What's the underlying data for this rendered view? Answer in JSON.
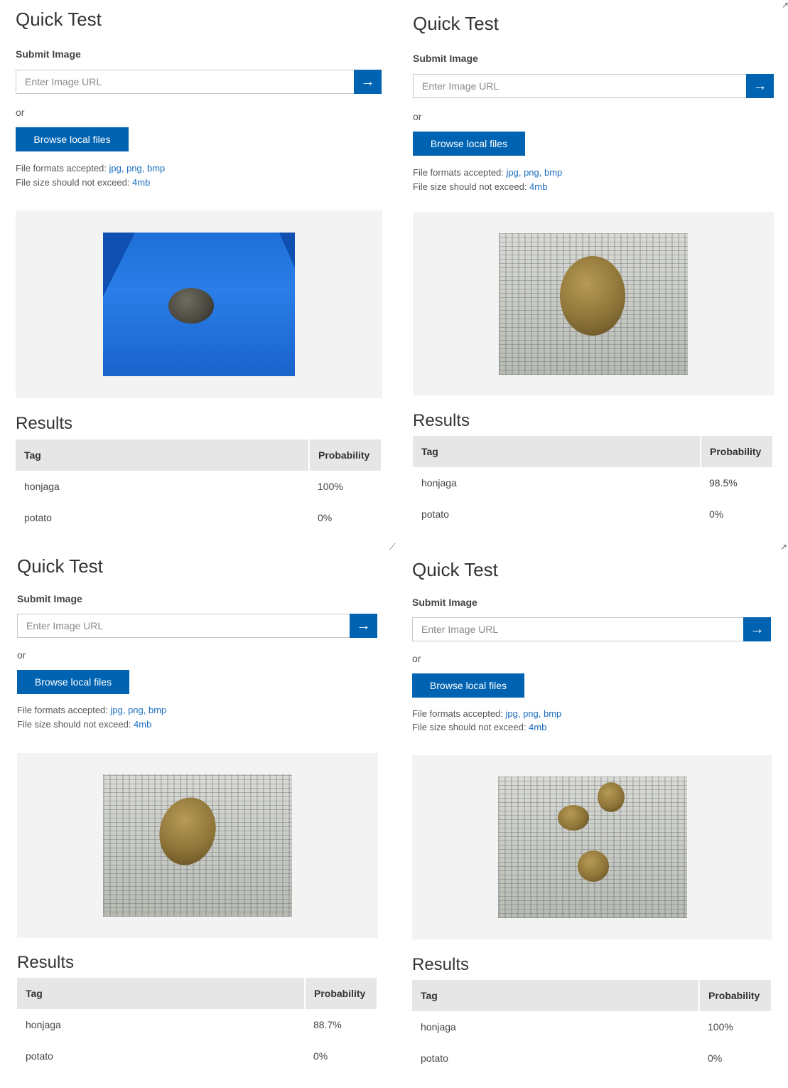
{
  "panels": [
    {
      "title": "Quick Test",
      "submit_label": "Submit Image",
      "url_placeholder": "Enter Image URL",
      "or": "or",
      "browse_label": "Browse local files",
      "formats_label": "File formats accepted: ",
      "formats": "jpg, png, bmp",
      "size_label": "File size should not exceed: ",
      "size": "4mb",
      "results_title": "Results",
      "col_tag": "Tag",
      "col_prob": "Probability",
      "rows": [
        {
          "tag": "honjaga",
          "prob": "100%"
        },
        {
          "tag": "potato",
          "prob": "0%"
        }
      ]
    },
    {
      "title": "Quick Test",
      "submit_label": "Submit Image",
      "url_placeholder": "Enter Image URL",
      "or": "or",
      "browse_label": "Browse local files",
      "formats_label": "File formats accepted: ",
      "formats": "jpg, png, bmp",
      "size_label": "File size should not exceed: ",
      "size": "4mb",
      "results_title": "Results",
      "col_tag": "Tag",
      "col_prob": "Probability",
      "rows": [
        {
          "tag": "honjaga",
          "prob": "98.5%"
        },
        {
          "tag": "potato",
          "prob": "0%"
        }
      ]
    },
    {
      "title": "Quick Test",
      "submit_label": "Submit Image",
      "url_placeholder": "Enter Image URL",
      "or": "or",
      "browse_label": "Browse local files",
      "formats_label": "File formats accepted: ",
      "formats": "jpg, png, bmp",
      "size_label": "File size should not exceed: ",
      "size": "4mb",
      "results_title": "Results",
      "col_tag": "Tag",
      "col_prob": "Probability",
      "rows": [
        {
          "tag": "honjaga",
          "prob": "88.7%"
        },
        {
          "tag": "potato",
          "prob": "0%"
        }
      ]
    },
    {
      "title": "Quick Test",
      "submit_label": "Submit Image",
      "url_placeholder": "Enter Image URL",
      "or": "or",
      "browse_label": "Browse local files",
      "formats_label": "File formats accepted: ",
      "formats": "jpg, png, bmp",
      "size_label": "File size should not exceed: ",
      "size": "4mb",
      "results_title": "Results",
      "col_tag": "Tag",
      "col_prob": "Probability",
      "rows": [
        {
          "tag": "honjaga",
          "prob": "100%"
        },
        {
          "tag": "potato",
          "prob": "0%"
        }
      ]
    }
  ],
  "icons": {
    "go": "arrow-right-icon",
    "corner": "expand-icon"
  },
  "colors": {
    "accent": "#0063b1",
    "link": "#1a6dbf",
    "preview_bg": "#f3f3f3",
    "table_header_bg": "#e6e6e6"
  }
}
